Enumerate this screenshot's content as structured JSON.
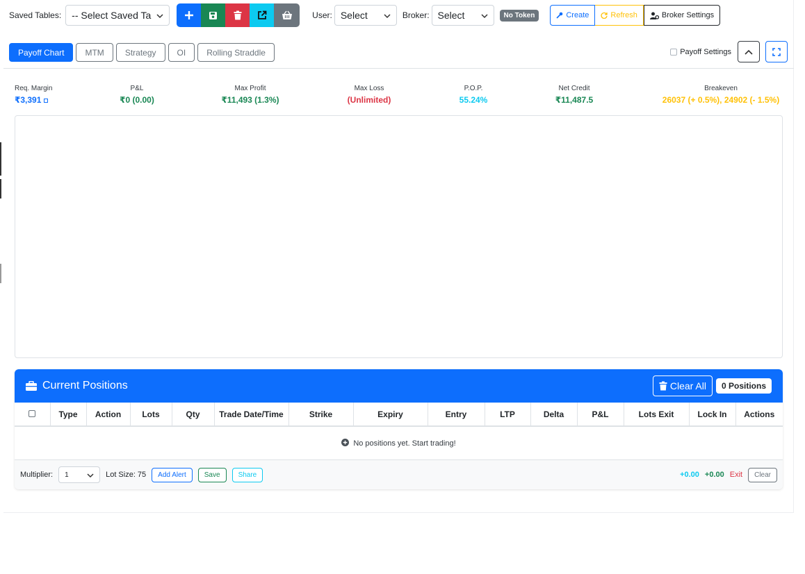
{
  "toolbar": {
    "saved_tables_label": "Saved Tables:",
    "saved_tables_value": "-- Select Saved Ta",
    "user_label": "User:",
    "user_value": "Select",
    "broker_label": "Broker:",
    "broker_value": "Select",
    "token_badge": "No Token",
    "create_label": "Create",
    "refresh_label": "Refresh",
    "broker_settings_label": "Broker Settings"
  },
  "tabs": [
    "Payoff Chart",
    "MTM",
    "Strategy",
    "OI",
    "Rolling Straddle"
  ],
  "payoff_settings_label": "Payoff Settings",
  "stats": [
    {
      "title": "Req. Margin",
      "value": "₹3,391",
      "color": "#0d6efd"
    },
    {
      "title": "P&L",
      "value": "₹0 (0.00)",
      "color": "#198754"
    },
    {
      "title": "Max Profit",
      "value": "₹11,493 (1.3%)",
      "color": "#198754"
    },
    {
      "title": "Max Loss",
      "value": "(Unlimited)",
      "color": "#dc3545"
    },
    {
      "title": "P.O.P.",
      "value": "55.24%",
      "color": "#0dcaf0"
    },
    {
      "title": "Net Credit",
      "value": "₹11,487.5",
      "color": "#198754"
    },
    {
      "title": "Breakeven",
      "value": "26037 (+ 0.5%), 24902 (- 1.5%)",
      "color": "#ffc107"
    }
  ],
  "positions": {
    "title": "Current Positions",
    "clear_all_label": "Clear All",
    "count_label": "0 Positions",
    "columns": [
      "Type",
      "Action",
      "Lots",
      "Qty",
      "Trade Date/Time",
      "Strike",
      "Expiry",
      "Entry",
      "LTP",
      "Delta",
      "P&L",
      "Lots Exit",
      "Lock In",
      "Actions"
    ],
    "empty_text": "No positions yet. Start trading!"
  },
  "footer": {
    "multiplier_label": "Multiplier:",
    "multiplier_value": "1",
    "lot_size_label": "Lot Size: 75",
    "add_alert_label": "Add Alert",
    "save_label": "Save",
    "share_label": "Share",
    "value_cyan": "+0.00",
    "value_green": "+0.00",
    "exit_label": "Exit",
    "clear_label": "Clear"
  },
  "colors": {
    "primary": "#0d6efd",
    "success": "#198754",
    "danger": "#dc3545",
    "info": "#0dcaf0",
    "warning": "#ffc107",
    "secondary": "#6c757d"
  }
}
